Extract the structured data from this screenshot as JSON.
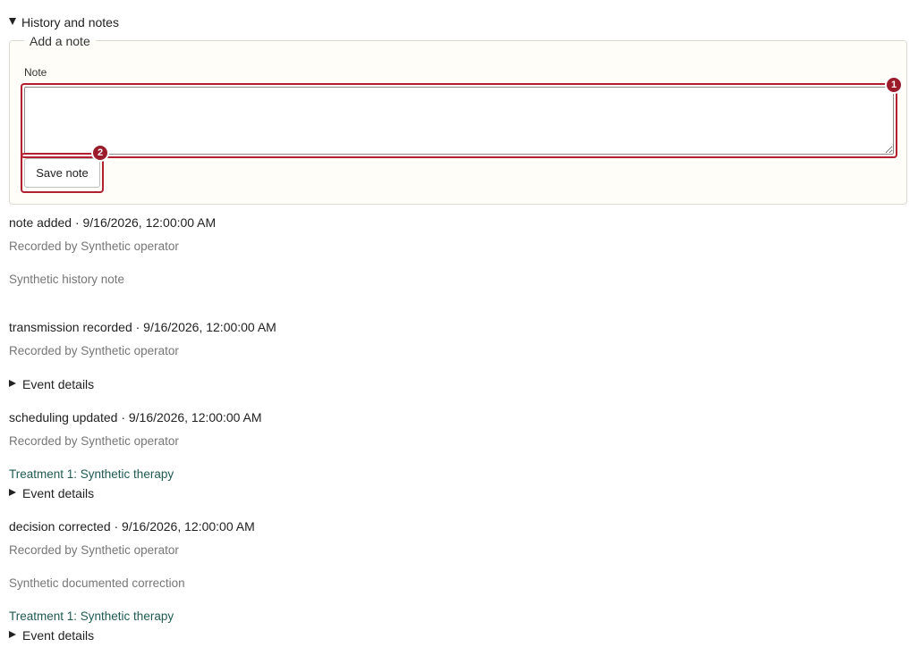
{
  "section": {
    "title": "History and notes"
  },
  "add_note": {
    "legend": "Add a note",
    "note_label": "Note",
    "note_value": "",
    "save_label": "Save note"
  },
  "badges": {
    "one": "1",
    "two": "2"
  },
  "events": [
    {
      "title": "note added · 9/16/2026, 12:00:00 AM",
      "recorded_by": "Recorded by Synthetic operator",
      "note": "Synthetic history note"
    },
    {
      "title": "transmission recorded · 9/16/2026, 12:00:00 AM",
      "recorded_by": "Recorded by Synthetic operator",
      "details_label": "Event details"
    },
    {
      "title": "scheduling updated · 9/16/2026, 12:00:00 AM",
      "recorded_by": "Recorded by Synthetic operator",
      "treatment": "Treatment 1: Synthetic therapy",
      "details_label": "Event details"
    },
    {
      "title": "decision corrected · 9/16/2026, 12:00:00 AM",
      "recorded_by": "Recorded by Synthetic operator",
      "note": "Synthetic documented correction",
      "treatment": "Treatment 1: Synthetic therapy",
      "details_label": "Event details"
    }
  ],
  "colors": {
    "highlight": "#b0202f",
    "badge": "#9b1b2a",
    "link": "#1e5a52",
    "muted": "#767676",
    "panel_bg": "#fefdf7"
  }
}
